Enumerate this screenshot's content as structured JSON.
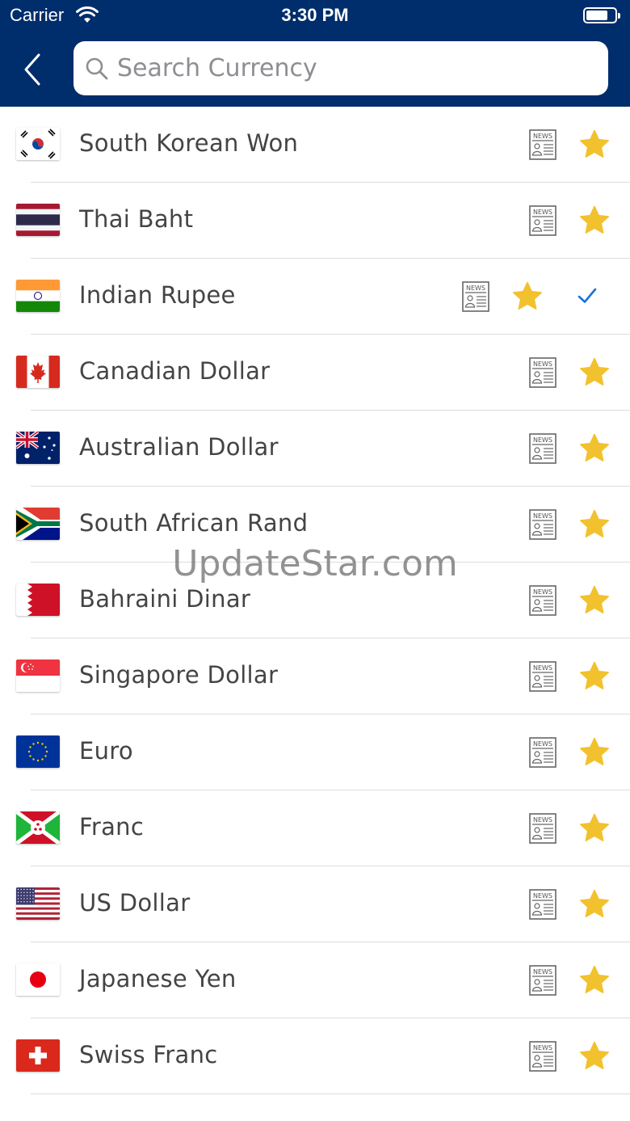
{
  "status_bar": {
    "carrier": "Carrier",
    "time": "3:30 PM"
  },
  "header": {
    "back_icon": "chevron-left-icon",
    "search": {
      "placeholder": "Search Currency",
      "value": "",
      "icon": "search-icon"
    }
  },
  "colors": {
    "nav_background": "#002d6b",
    "star": "#f2c12e",
    "check": "#1a73d9",
    "text": "#444444"
  },
  "currencies": [
    {
      "name": "South Korean Won",
      "flag": "KR",
      "selected": false
    },
    {
      "name": "Thai Baht",
      "flag": "TH",
      "selected": false
    },
    {
      "name": "Indian Rupee",
      "flag": "IN",
      "selected": true
    },
    {
      "name": "Canadian Dollar",
      "flag": "CA",
      "selected": false
    },
    {
      "name": "Australian Dollar",
      "flag": "AU",
      "selected": false
    },
    {
      "name": "South African Rand",
      "flag": "ZA",
      "selected": false
    },
    {
      "name": "Bahraini Dinar",
      "flag": "BH",
      "selected": false
    },
    {
      "name": "Singapore Dollar",
      "flag": "SG",
      "selected": false
    },
    {
      "name": "Euro",
      "flag": "EU",
      "selected": false
    },
    {
      "name": "Franc",
      "flag": "BI",
      "selected": false
    },
    {
      "name": "US Dollar",
      "flag": "US",
      "selected": false
    },
    {
      "name": "Japanese Yen",
      "flag": "JP",
      "selected": false
    },
    {
      "name": "Swiss Franc",
      "flag": "CH",
      "selected": false
    }
  ],
  "row_icons": {
    "news": "news-icon",
    "favorite": "star-icon",
    "selected": "checkmark-icon"
  },
  "watermark": "UpdateStar.com"
}
